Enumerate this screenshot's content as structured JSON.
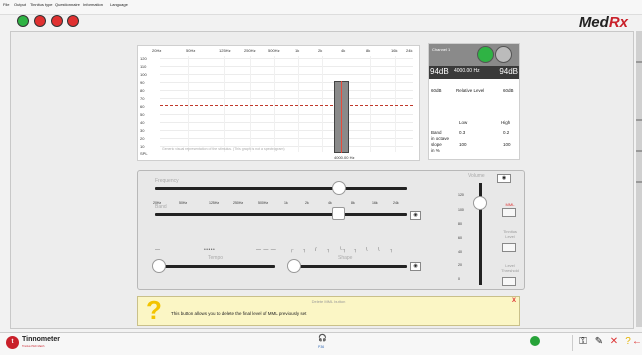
{
  "menu": [
    "File",
    "Output",
    "Tinnitus type",
    "Questionnaire",
    "Information",
    "Language"
  ],
  "top_buttons": [
    {
      "name": "green",
      "color": "#2fb344"
    },
    {
      "name": "red-1",
      "color": "#e03131"
    },
    {
      "name": "red-2",
      "color": "#e03131"
    },
    {
      "name": "red-3",
      "color": "#e03131"
    }
  ],
  "logo": {
    "text_main": "Med",
    "text_accent": "Rx"
  },
  "spectrum": {
    "freq_labels": [
      "20Hz",
      "50Hz",
      "125Hz",
      "250Hz",
      "500Hz",
      "1k",
      "2k",
      "4k",
      "8k",
      "16k",
      "24k"
    ],
    "db_labels": [
      "120",
      "110",
      "100",
      "90",
      "80",
      "70",
      "60",
      "50",
      "40",
      "30",
      "20",
      "10",
      "SPL"
    ],
    "caption": "Generic visual representation of the stimulus. (This graph is not a spectrogram)",
    "center_label": "4000.00 Hz"
  },
  "info": {
    "channel": "Channel 1",
    "level_left": "94dB",
    "frequency": "4000.00 Hz",
    "level_right": "94dB",
    "rel_left": "60dB",
    "rel_title": "Relative Level",
    "rel_right": "60dB",
    "col_low": "Low",
    "col_high": "High",
    "row_band": "Band",
    "row_octave": "in octave",
    "band_low": "0.3",
    "band_high": "0.2",
    "row_slope": "slope",
    "row_slope_unit": "in %",
    "slope_low": "100",
    "slope_high": "100"
  },
  "controls": {
    "frequency_label": "Frequency",
    "band_label": "Band",
    "tempo_label": "Tempo",
    "shape_label": "Shape",
    "volume_label": "Volume",
    "mml_label": "MML",
    "tinnitus_level_label": "Tinnitus Level",
    "level_threshold_label": "Level Threshold",
    "freq_ticks": [
      "20Hz",
      "50Hz",
      "125Hz",
      "250Hz",
      "500Hz",
      "1k",
      "2k",
      "4k",
      "8k",
      "16k",
      "24k"
    ],
    "tempo_symbols": [
      "—",
      "•••••",
      "— — —"
    ],
    "shape_symbols": [
      "┌",
      "┐",
      "/",
      "┐",
      "└┐",
      "┐",
      "\\",
      "\\",
      "┐"
    ],
    "volume_ticks": [
      "120",
      "100",
      "80",
      "60",
      "40",
      "20",
      "0"
    ],
    "frequency_position": 0.73,
    "band_position": 0.73,
    "tempo_position": 0.03,
    "shape_position": 0.03,
    "volume_position": 0.2
  },
  "tooltip": {
    "title": "Delete MML button",
    "text": "This button allows you to delete the  final level of MML previously set",
    "close": "X",
    "icon": "?"
  },
  "bottom": {
    "brand": "Tinnometer",
    "brand_sub": "Tinnitus Pitch Match",
    "headphone_label": "P36",
    "status_color": "#27a339",
    "icons": [
      "key-icon",
      "pin-icon",
      "close-icon",
      "help-icon",
      "back-icon"
    ]
  }
}
